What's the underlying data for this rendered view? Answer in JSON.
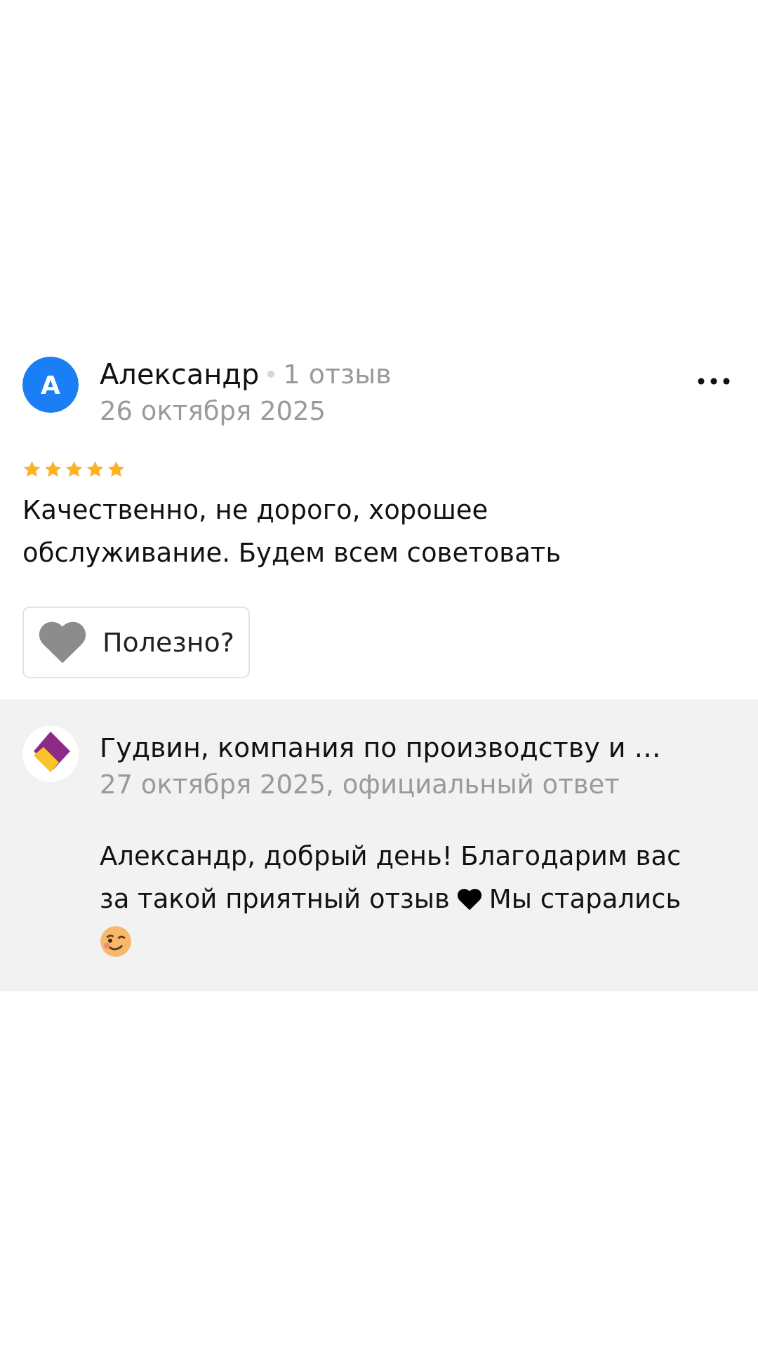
{
  "review": {
    "author_initial": "А",
    "author": "Александр",
    "author_reviews": "1 отзыв",
    "date": "26 октября 2025",
    "stars": 5,
    "text": "Качественно, не дорого, хорошее обслуживание. Будем всем советовать",
    "helpful_label": "Полезно?"
  },
  "reply": {
    "company": "Гудвин, компания по производству и …",
    "date": "27 октября 2025, официальный ответ",
    "text_parts": [
      "Александр, добрый день! Благодарим вас",
      "за такой приятный отзыв",
      "Мы старались"
    ]
  }
}
